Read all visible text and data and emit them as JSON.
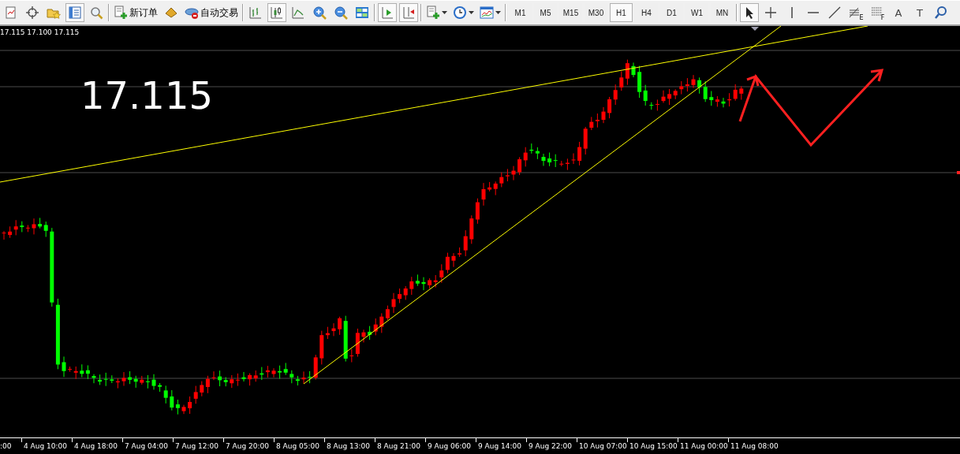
{
  "toolbar": {
    "groups": [
      [
        {
          "kind": "icon",
          "pressed": false
        },
        {
          "kind": "icon",
          "pressed": false
        },
        {
          "kind": "icon",
          "pressed": false
        },
        {
          "kind": "icon",
          "pressed": true
        },
        {
          "kind": "icon",
          "pressed": false
        }
      ],
      [
        {
          "kind": "labeled",
          "label": "新订单"
        },
        {
          "kind": "icon",
          "pressed": false
        },
        {
          "kind": "labeled",
          "label": "自动交易"
        }
      ],
      [
        {
          "kind": "icon",
          "pressed": false
        },
        {
          "kind": "icon",
          "pressed": true
        },
        {
          "kind": "icon",
          "pressed": false
        },
        {
          "kind": "icon",
          "pressed": false
        },
        {
          "kind": "icon",
          "pressed": false
        },
        {
          "kind": "icon",
          "pressed": false
        }
      ],
      [
        {
          "kind": "icon",
          "pressed": true
        },
        {
          "kind": "icon",
          "pressed": true
        }
      ],
      [
        {
          "kind": "dropdown"
        },
        {
          "kind": "dropdown"
        },
        {
          "kind": "dropdown"
        }
      ],
      [
        {
          "kind": "timeframe",
          "label": "M1",
          "selected": false
        },
        {
          "kind": "timeframe",
          "label": "M5",
          "selected": false
        },
        {
          "kind": "timeframe",
          "label": "M15",
          "selected": false
        },
        {
          "kind": "timeframe",
          "label": "M30",
          "selected": false
        },
        {
          "kind": "timeframe",
          "label": "H1",
          "selected": true
        },
        {
          "kind": "timeframe",
          "label": "H4",
          "selected": false
        },
        {
          "kind": "timeframe",
          "label": "D1",
          "selected": false
        },
        {
          "kind": "timeframe",
          "label": "W1",
          "selected": false
        },
        {
          "kind": "timeframe",
          "label": "MN",
          "selected": false
        }
      ],
      [
        {
          "kind": "icon",
          "pressed": true
        },
        {
          "kind": "icon",
          "pressed": false
        },
        {
          "kind": "icon",
          "pressed": false
        },
        {
          "kind": "icon",
          "pressed": false
        },
        {
          "kind": "icon",
          "pressed": false
        },
        {
          "kind": "icon",
          "pressed": false,
          "label": "E"
        },
        {
          "kind": "icon",
          "pressed": false,
          "label": "F"
        },
        {
          "kind": "glyph",
          "label": "A"
        },
        {
          "kind": "glyph",
          "label": "T"
        },
        {
          "kind": "icon",
          "pressed": false
        }
      ]
    ]
  },
  "chart": {
    "ohlc": "17.115 17.100 17.115",
    "price": "17.115",
    "time_axis": [
      ":00",
      "4 Aug 10:00",
      "4 Aug 18:00",
      "7 Aug 04:00",
      "7 Aug 12:00",
      "7 Aug 20:00",
      "8 Aug 05:00",
      "8 Aug 13:00",
      "8 Aug 21:00",
      "9 Aug 06:00",
      "9 Aug 14:00",
      "9 Aug 22:00",
      "10 Aug 07:00",
      "10 Aug 15:00",
      "11 Aug 00:00",
      "11 Aug 08:00"
    ]
  }
}
